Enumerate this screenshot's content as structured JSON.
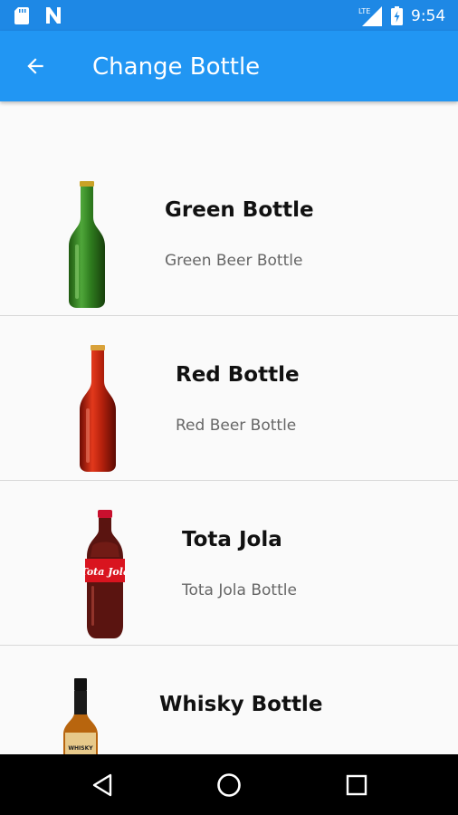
{
  "status_bar": {
    "time": "9:54",
    "network_label": "LTE",
    "icons": [
      "sd-card-icon",
      "n-notification-icon",
      "signal-icon",
      "battery-charging-icon"
    ]
  },
  "app_bar": {
    "title": "Change Bottle",
    "back_icon": "arrow-back-icon"
  },
  "bottles": [
    {
      "title": "Green Bottle",
      "subtitle": "Green Beer Bottle",
      "image": "green-beer-bottle"
    },
    {
      "title": "Red Bottle",
      "subtitle": "Red Beer Bottle",
      "image": "red-beer-bottle"
    },
    {
      "title": "Tota Jola",
      "subtitle": "Tota Jola Bottle",
      "image": "cola-bottle",
      "label_text": "Tota Jola"
    },
    {
      "title": "Whisky Bottle",
      "subtitle": "",
      "image": "whisky-bottle",
      "label_text": "WHISKY"
    }
  ],
  "nav_bar": {
    "icons": [
      "back-triangle-icon",
      "home-circle-icon",
      "recents-square-icon"
    ]
  },
  "colors": {
    "status_bar": "#1e88e5",
    "app_bar": "#2196f3",
    "background": "#fafafa",
    "nav_bar": "#000000"
  }
}
